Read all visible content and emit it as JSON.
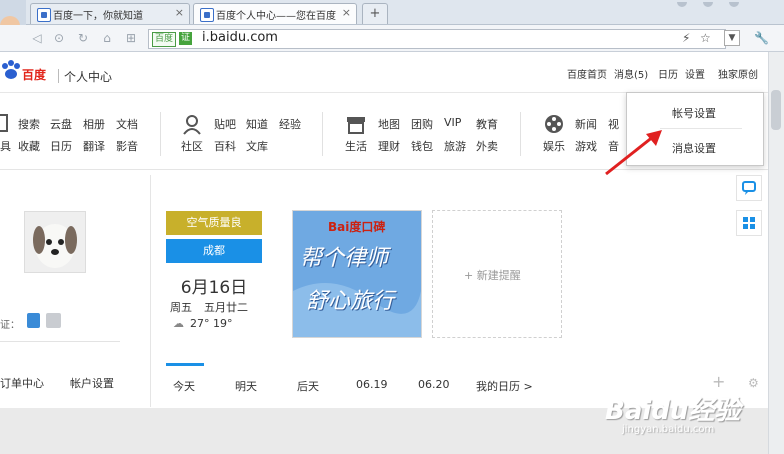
{
  "browser": {
    "tabs": [
      {
        "label": "百度一下，你就知道",
        "close": "×"
      },
      {
        "label": "百度个人中心——您在百度",
        "close": "×"
      }
    ],
    "new_tab": "+",
    "address": {
      "badge": "百度",
      "badge2": "证",
      "url": "i.baidu.com"
    }
  },
  "header": {
    "logo_text": "百度",
    "logo_sub": "个人中心",
    "links": [
      "百度首页",
      "消息(5)",
      "日历",
      "设置",
      "独家原创"
    ]
  },
  "services": {
    "group1_row1": [
      "搜索",
      "云盘",
      "相册",
      "文档"
    ],
    "group1_row2": [
      "具",
      "收藏",
      "日历",
      "翻译",
      "影音"
    ],
    "group2_row1": [
      "贴吧",
      "知道",
      "经验"
    ],
    "group2_row2": [
      "社区",
      "百科",
      "文库"
    ],
    "group3_row1": [
      "地图",
      "团购",
      "VIP",
      "教育"
    ],
    "group3_row2": [
      "生活",
      "理财",
      "钱包",
      "旅游",
      "外卖"
    ],
    "group4_row1": [
      "新闻",
      "视"
    ],
    "group4_row2": [
      "娱乐",
      "游戏",
      "音"
    ]
  },
  "profile": {
    "cert_label": "证：",
    "order_center": "订单中心",
    "account_settings": "帐户设置"
  },
  "weather": {
    "air_quality": "空气质量良",
    "city": "成都",
    "date": "6月16日",
    "weekday": "周五",
    "lunar": "五月廿二",
    "temp": "27° 19°"
  },
  "ad": {
    "brand": "Bai度口碑",
    "line1": "帮个律师",
    "line2": "舒心旅行"
  },
  "reminder": {
    "label": "+ 新建提醒"
  },
  "days": [
    "今天",
    "明天",
    "后天",
    "06.19",
    "06.20",
    "我的日历 >"
  ],
  "dropdown": {
    "item1": "帐号设置",
    "item2": "消息设置"
  },
  "watermark": {
    "text": "Baidu经验",
    "sub": "jingyan.baidu.com"
  },
  "colors": {
    "accent": "#1a90e6",
    "air": "#c8b02b",
    "arrow": "#e02020"
  }
}
